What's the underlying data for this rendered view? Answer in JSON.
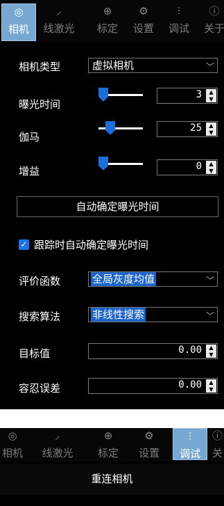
{
  "tabs_top": [
    {
      "icon_name": "camera-icon",
      "label": "相机",
      "icon": "◎",
      "active": true
    },
    {
      "icon_name": "laser-line-icon",
      "label": "线激光",
      "icon": "⸝",
      "active": false
    },
    {
      "icon_name": "crosshair-icon",
      "label": "标定",
      "icon": "⊕",
      "active": false
    },
    {
      "icon_name": "settings-icon",
      "label": "设置",
      "icon": "⚙",
      "active": false
    },
    {
      "icon_name": "tuning-icon",
      "label": "调试",
      "icon": "⫶",
      "active": false
    },
    {
      "icon_name": "info-icon",
      "label": "关于",
      "icon": "ⓘ",
      "active": false
    }
  ],
  "camera": {
    "type_label": "相机类型",
    "type_value": "虚拟相机",
    "exposure_label": "曝光时间",
    "exposure_value": "3",
    "gamma_label": "伽马",
    "gamma_value": "25",
    "gain_label": "增益",
    "gain_value": "0",
    "auto_exposure_button": "自动确定曝光时间",
    "track_auto_label": "跟踪时自动确定曝光时间",
    "track_auto_checked": true,
    "eval_label": "评价函数",
    "eval_value": "全局灰度均值",
    "search_label": "搜索算法",
    "search_value": "非线性搜索",
    "target_label": "目标值",
    "target_value": "0.00",
    "tolerance_label": "容忍误差",
    "tolerance_value": "0.00"
  },
  "sliders": {
    "exposure": 0.05,
    "gamma": 0.25,
    "gain": 0.05
  },
  "tabs_bottom": [
    {
      "icon_name": "camera-icon",
      "label": "相机",
      "icon": "◎",
      "active": false
    },
    {
      "icon_name": "laser-line-icon",
      "label": "线激光",
      "icon": "⸝",
      "active": false
    },
    {
      "icon_name": "crosshair-icon",
      "label": "标定",
      "icon": "⊕",
      "active": false
    },
    {
      "icon_name": "settings-icon",
      "label": "设置",
      "icon": "⚙",
      "active": false
    },
    {
      "icon_name": "tuning-icon",
      "label": "调试",
      "icon": "⫶",
      "active": true
    },
    {
      "icon_name": "info-icon",
      "label": "关",
      "icon": "ⓘ",
      "active": false
    }
  ],
  "reconnect_button": "重连相机",
  "colors": {
    "accent": "#1a6fdb",
    "tab_active": "#77a8d2",
    "highlight": "#1d64c8"
  }
}
